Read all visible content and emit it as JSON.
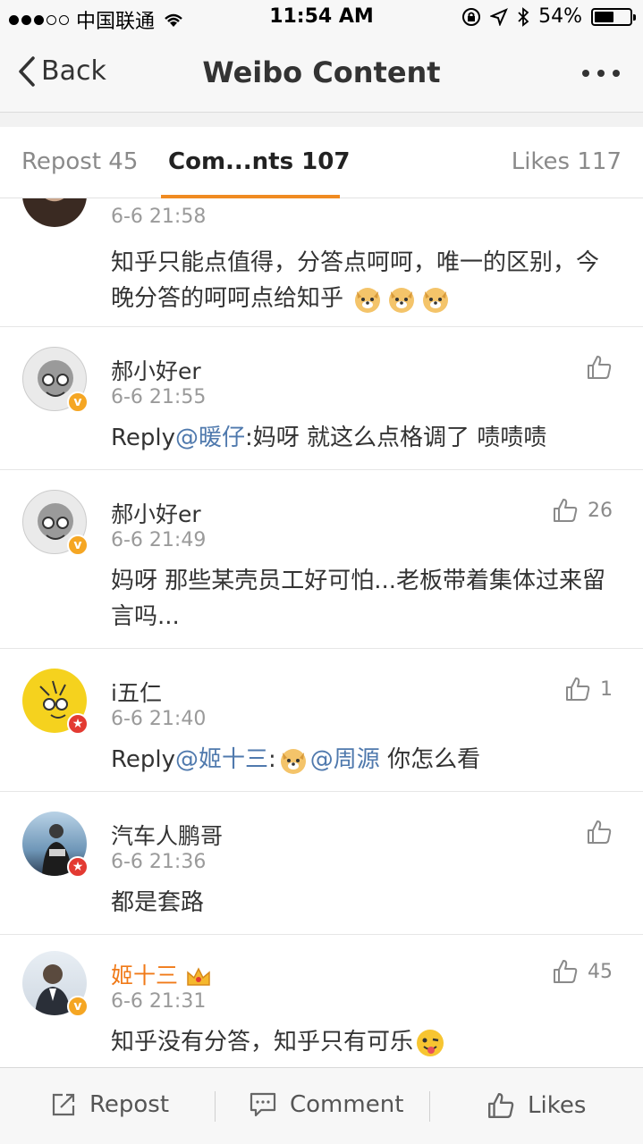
{
  "status_bar": {
    "carrier": "中国联通",
    "time": "11:54 AM",
    "battery": "54%",
    "battery_level": 0.54
  },
  "nav": {
    "back_label": "Back",
    "title": "Weibo Content"
  },
  "tabs": {
    "repost": "Repost 45",
    "comments": "Com...nts 107",
    "likes": "Likes 117"
  },
  "comments": [
    {
      "time": "6-6 21:58",
      "text": "知乎只能点值得，分答点呵呵，唯一的区别，今晚分答的呵呵点给知乎"
    },
    {
      "name": "郝小好er",
      "time": "6-6 21:55",
      "reply_prefix": "Reply",
      "mention": "@暖仔",
      "text": ":妈呀 就这么点格调了 啧啧啧"
    },
    {
      "name": "郝小好er",
      "time": "6-6 21:49",
      "likes": "26",
      "text": "妈呀 那些某壳员工好可怕...老板带着集体过来留言吗..."
    },
    {
      "name": "i五仁",
      "time": "6-6 21:40",
      "likes": "1",
      "reply_prefix": "Reply",
      "mention": "@姬十三",
      "mention2": "@周源",
      "text": " 你怎么看"
    },
    {
      "name": "汽车人鹏哥",
      "time": "6-6 21:36",
      "text": "都是套路"
    },
    {
      "name": "姬十三",
      "time": "6-6 21:31",
      "likes": "45",
      "text": "知乎没有分答，知乎只有可乐"
    }
  ],
  "toolbar": {
    "repost": "Repost",
    "comment": "Comment",
    "likes": "Likes"
  },
  "colors": {
    "accent": "#f08b22",
    "mention": "#4f79ad",
    "vip_name": "#f07a18"
  }
}
